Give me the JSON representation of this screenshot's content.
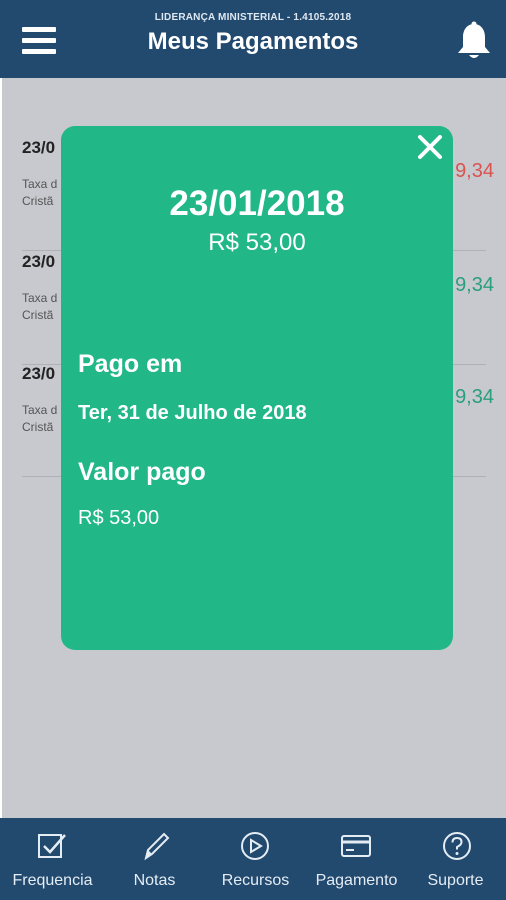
{
  "header": {
    "subtitle": "LIDERANÇA MINISTERIAL - 1.4105.2018",
    "title": "Meus Pagamentos"
  },
  "list": [
    {
      "date": "23/0",
      "desc_line1": "Taxa d",
      "desc_line2": "Cristã",
      "value": "9,34",
      "status_color": "#d9534f"
    },
    {
      "date": "23/0",
      "desc_line1": "Taxa d",
      "desc_line2": "Cristã",
      "value": "9,34",
      "status_color": "#2a9e7d"
    },
    {
      "date": "23/0",
      "desc_line1": "Taxa d",
      "desc_line2": "Cristã",
      "value": "9,34",
      "status_color": "#2a9e7d"
    }
  ],
  "modal": {
    "date": "23/01/2018",
    "amount": "R$ 53,00",
    "paid_on_label": "Pago em",
    "paid_on_value": "Ter, 31 de Julho de 2018",
    "paid_value_label": "Valor pago",
    "paid_value": "R$ 53,00",
    "close_icon": "close-icon",
    "background_color": "#21b786"
  },
  "bottom_nav": [
    {
      "label": "Frequencia",
      "icon": "checkbox-icon"
    },
    {
      "label": "Notas",
      "icon": "pencil-icon"
    },
    {
      "label": "Recursos",
      "icon": "play-circle-icon"
    },
    {
      "label": "Pagamento",
      "icon": "credit-card-icon"
    },
    {
      "label": "Suporte",
      "icon": "help-circle-icon"
    }
  ],
  "colors": {
    "header": "#22496e",
    "overlay": "#c7c9cf"
  }
}
